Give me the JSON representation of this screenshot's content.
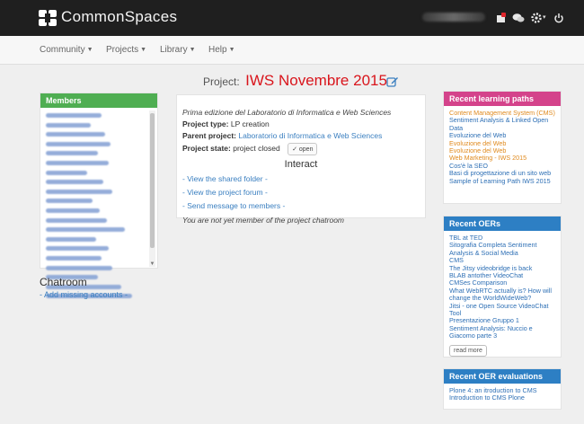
{
  "brand": {
    "name": "CommonSpaces"
  },
  "nav": [
    {
      "label": "Community"
    },
    {
      "label": "Projects"
    },
    {
      "label": "Library"
    },
    {
      "label": "Help"
    }
  ],
  "page": {
    "title_prefix": "Project:",
    "title": "IWS Novembre 2015"
  },
  "members": {
    "title": "Members",
    "count_rows": 20
  },
  "chatroom": {
    "title": "Chatroom",
    "add_link": "- Add missing accounts -"
  },
  "project": {
    "description": "Prima edizione del Laboratorio di Informatica e Web Sciences",
    "type_label": "Project type:",
    "type_value": "LP creation",
    "parent_label": "Parent project:",
    "parent_value": "Laboratorio di Informatica e Web Sciences",
    "state_label": "Project state:",
    "state_value": "project closed",
    "open_button": "open",
    "interact_title": "Interact",
    "links": [
      "- View the shared folder -",
      "- View the project forum -",
      "- Send message to members -"
    ],
    "note": "You are not yet member of the project chatroom"
  },
  "learning_paths": {
    "title": "Recent learning paths",
    "items": [
      {
        "label": "Content Management System (CMS)",
        "color": "orange"
      },
      {
        "label": "Sentiment Analysis & Linked Open Data",
        "color": "blue"
      },
      {
        "label": "Evoluzione del Web",
        "color": "blue"
      },
      {
        "label": "Evoluzione del Web",
        "color": "orange"
      },
      {
        "label": "Evoluzione del Web",
        "color": "orange"
      },
      {
        "label": "Web Marketing - IWS 2015",
        "color": "orange"
      },
      {
        "label": "Cos'è la SEO",
        "color": "blue"
      },
      {
        "label": "Basi di progettazione di un sito web",
        "color": "blue"
      },
      {
        "label": "Sample of Learning Path IWS 2015",
        "color": "blue"
      }
    ]
  },
  "oers": {
    "title": "Recent OERs",
    "items": [
      "TBL at TED",
      "Sitografia Completa Sentiment Analysis & Social Media",
      "CMS",
      "The Jitsy videobridge is back",
      "BLAB antother VideoChat",
      "CMSes Comparison",
      "What WebRTC actually is? How will change the WorldWideWeb?",
      "Jitsi - one Open Source VideoChat Tool",
      "Presentazione Gruppo 1",
      "Sentiment Analysis: Nuccio e Giacomo parte 3"
    ],
    "read_more": "read more"
  },
  "oer_evaluations": {
    "title": "Recent OER evaluations",
    "items": [
      "Plone 4: an itroduction to CMS",
      "Introduction to CMS Plone"
    ]
  },
  "colors": {
    "accent_red": "#d9151c",
    "members_green": "#4fae52",
    "paths_pink": "#d4438b",
    "oer_blue": "#2d7fc4",
    "link_orange": "#e08a1e"
  }
}
